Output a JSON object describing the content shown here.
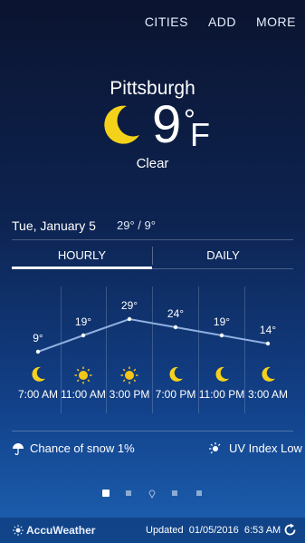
{
  "nav": {
    "cities": "CITIES",
    "add": "ADD",
    "more": "MORE"
  },
  "location": {
    "city": "Pittsburgh",
    "temp": "9",
    "degree": "°",
    "unit": "F",
    "condition": "Clear"
  },
  "date": {
    "label": "Tue, January 5",
    "hilo": "29° / 9°"
  },
  "tabs": {
    "hourly": "HOURLY",
    "daily": "DAILY",
    "active": "hourly"
  },
  "hourly": [
    {
      "temp": "9°",
      "time": "7:00 AM",
      "icon": "moon-icon",
      "value": 9
    },
    {
      "temp": "19°",
      "time": "11:00 AM",
      "icon": "sun-icon",
      "value": 19
    },
    {
      "temp": "29°",
      "time": "3:00 PM",
      "icon": "sun-icon",
      "value": 29
    },
    {
      "temp": "24°",
      "time": "7:00 PM",
      "icon": "moon-icon",
      "value": 24
    },
    {
      "temp": "19°",
      "time": "11:00 PM",
      "icon": "moon-icon",
      "value": 19
    },
    {
      "temp": "14°",
      "time": "3:00 AM",
      "icon": "moon-icon",
      "value": 14
    }
  ],
  "info": {
    "snow": "Chance of snow 1%",
    "uv": "UV Index Low"
  },
  "footer": {
    "brand": "AccuWeather",
    "updated": "Updated  01/05/2016  6:53 AM"
  },
  "colors": {
    "moon": "#f5d21a",
    "sun": "#f5c518",
    "line": "#8fb0e0"
  }
}
